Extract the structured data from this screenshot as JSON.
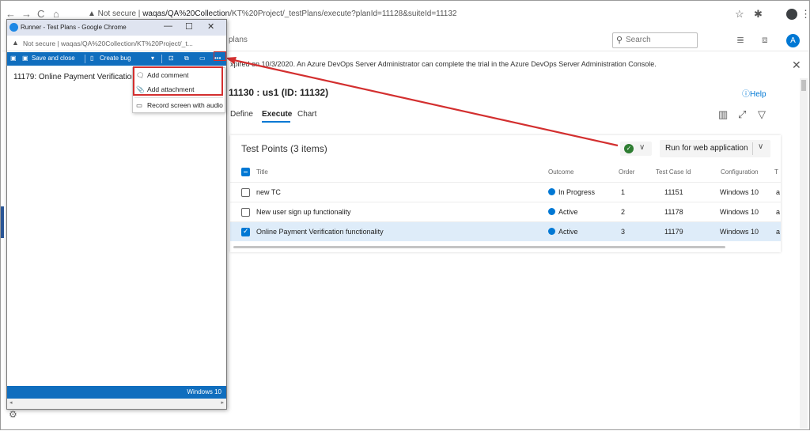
{
  "browser": {
    "back": "←",
    "forward": "→",
    "reload": "C",
    "home": "⌂",
    "not_secure": "▲ Not secure",
    "url_host": "waqas/QA%20Collection",
    "url_path": "/KT%20Project/_testPlans/execute?planId=11128&suiteId=11132",
    "star": "☆",
    "extensions": "✱",
    "menu": "⋮"
  },
  "header": {
    "plans_crumb": "plans",
    "search_placeholder": "Search",
    "search_icon": "⚲",
    "list_icon": "≣",
    "bag_icon": "⧈",
    "user_initial": "A"
  },
  "banner": {
    "text": "xpired on 10/3/2020. An Azure DevOps Server Administrator can complete the trial in the Azure DevOps Server Administration Console.",
    "close": "✕"
  },
  "suite": {
    "title": "11130 : us1 (ID: 11132)",
    "help": "ⓘHelp",
    "tabs": [
      "Define",
      "Execute",
      "Chart"
    ],
    "tools": [
      "▥",
      "⤢",
      "▽"
    ]
  },
  "test_points": {
    "title": "Test Points (3 items)",
    "run_label": "Run for web application",
    "chevron": "∨",
    "columns": [
      "Title",
      "Outcome",
      "Order",
      "Test Case Id",
      "Configuration",
      "T"
    ],
    "rows": [
      {
        "title": "new TC",
        "outcome": "In Progress",
        "order": "1",
        "case_id": "11151",
        "config": "Windows 10",
        "tail": "a",
        "checked": false
      },
      {
        "title": "New user sign up functionality",
        "outcome": "Active",
        "order": "2",
        "case_id": "11178",
        "config": "Windows 10",
        "tail": "a",
        "checked": false
      },
      {
        "title": "Online Payment Verification functionality",
        "outcome": "Active",
        "order": "3",
        "case_id": "11179",
        "config": "Windows 10",
        "tail": "a",
        "checked": true
      }
    ],
    "outcome_color": "#0078d4"
  },
  "popup": {
    "title": "Runner - Test Plans - Google Chrome",
    "minimize": "—",
    "maximize": "☐",
    "close": "✕",
    "warn": "▲",
    "address": "Not secure | waqas/QA%20Collection/KT%20Project/_t...",
    "toolbar": {
      "save_icon": "💾",
      "save_close": "Save and close",
      "create_bug": "Create bug",
      "dropdown": "▾",
      "screenshot_icon": "⊡",
      "capture_icon": "⧉",
      "record_icon": "▭",
      "more": "•••"
    },
    "item": "11179: Online Payment Verification functionality",
    "status": "Windows 10",
    "left_arrow": "◂",
    "right_arrow": "▸",
    "settings_icon": "⚙"
  },
  "menu": {
    "items": [
      {
        "icon": "🗨",
        "label": "Add comment"
      },
      {
        "icon": "📎",
        "label": "Add attachment"
      },
      {
        "icon": "▭",
        "label": "Record screen with audio"
      }
    ]
  },
  "colors": {
    "accent": "#0078d4",
    "toolbar_blue": "#106ebe",
    "highlight_red": "#d32f2f",
    "success": "#2e7d32"
  }
}
